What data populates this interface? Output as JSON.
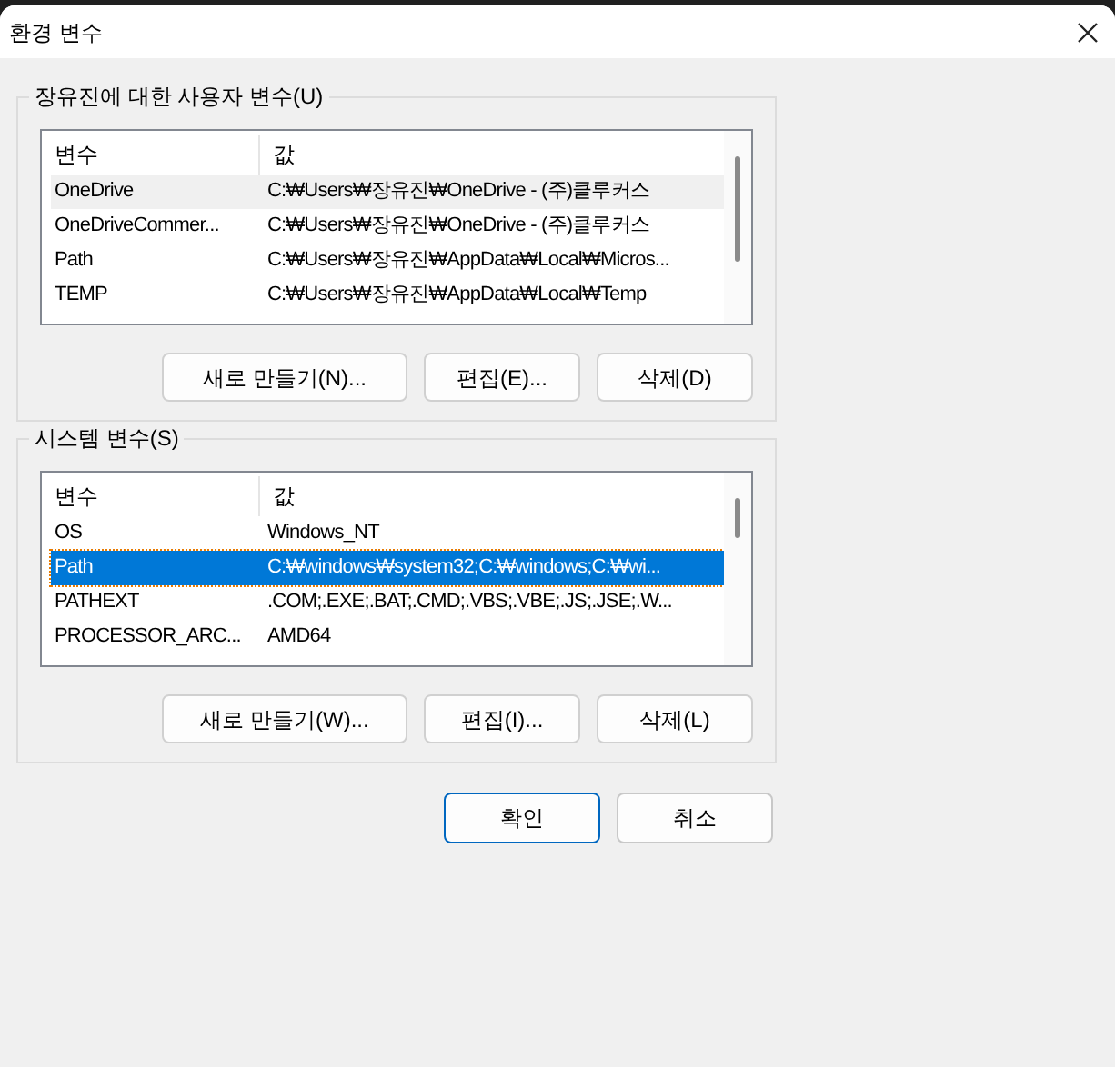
{
  "window": {
    "title": "환경 변수"
  },
  "groups": [
    {
      "title": "장유진에 대한 사용자 변수(U)",
      "focused": false,
      "columns": [
        "변수",
        "값"
      ],
      "rows": [
        {
          "name": "OneDrive",
          "value": "C:₩Users₩장유진₩OneDrive - (주)클루커스",
          "selected": true
        },
        {
          "name": "OneDriveCommer...",
          "value": "C:₩Users₩장유진₩OneDrive - (주)클루커스",
          "selected": false
        },
        {
          "name": "Path",
          "value": "C:₩Users₩장유진₩AppData₩Local₩Micros...",
          "selected": false
        },
        {
          "name": "TEMP",
          "value": "C:₩Users₩장유진₩AppData₩Local₩Temp",
          "selected": false
        }
      ],
      "buttons": [
        "새로 만들기(N)...",
        "편집(E)...",
        "삭제(D)"
      ]
    },
    {
      "title": "시스템 변수(S)",
      "focused": true,
      "columns": [
        "변수",
        "값"
      ],
      "rows": [
        {
          "name": "OS",
          "value": "Windows_NT",
          "selected": false
        },
        {
          "name": "Path",
          "value": "C:₩windows₩system32;C:₩windows;C:₩wi...",
          "selected": true
        },
        {
          "name": "PATHEXT",
          "value": ".COM;.EXE;.BAT;.CMD;.VBS;.VBE;.JS;.JSE;.W...",
          "selected": false
        },
        {
          "name": "PROCESSOR_ARC...",
          "value": "AMD64",
          "selected": false
        }
      ],
      "buttons": [
        "새로 만들기(W)...",
        "편집(I)...",
        "삭제(L)"
      ]
    }
  ],
  "footer_buttons": [
    {
      "label": "확인",
      "default": true
    },
    {
      "label": "취소",
      "default": false
    }
  ]
}
